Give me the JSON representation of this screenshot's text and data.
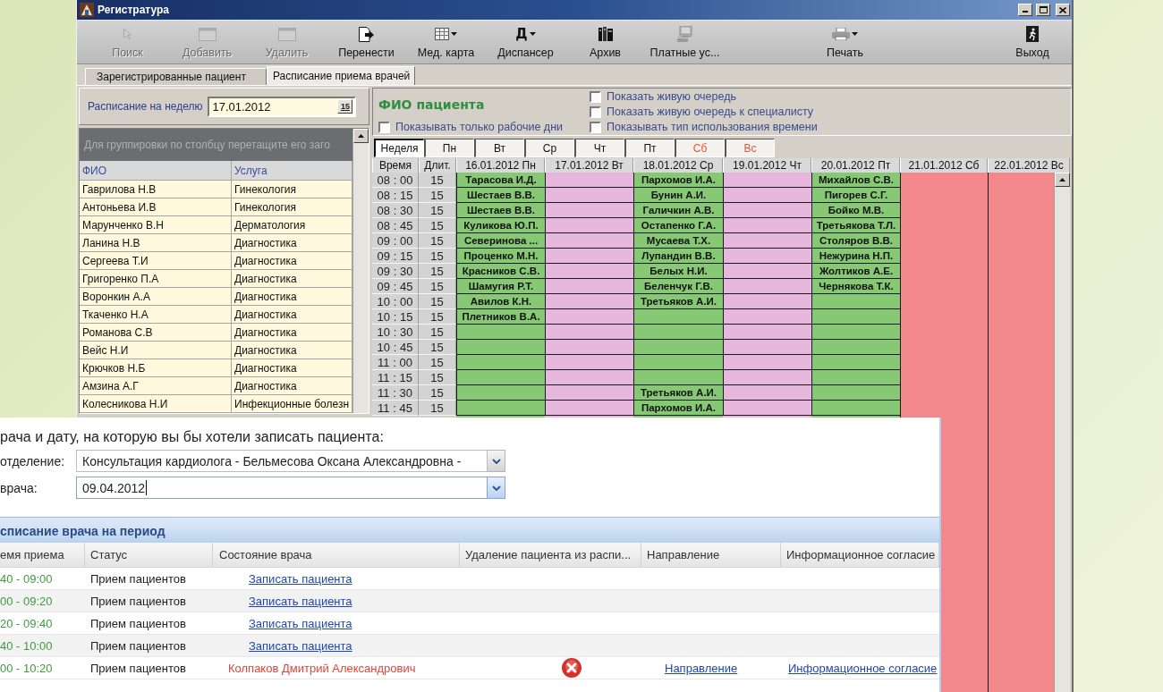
{
  "window": {
    "title": "Регистратура"
  },
  "toolbar": {
    "groups": [
      [
        {
          "label": "Поиск",
          "disabled": true,
          "dropdown": false
        },
        {
          "label": "Добавить",
          "disabled": true,
          "dropdown": false
        },
        {
          "label": "Удалить",
          "disabled": true,
          "dropdown": false
        },
        {
          "label": "Перенести",
          "disabled": false,
          "dropdown": false
        },
        {
          "label": "Мед. карта",
          "disabled": false,
          "dropdown": true
        },
        {
          "label": "Диспансер",
          "disabled": false,
          "dropdown": true,
          "glyph": "Д"
        },
        {
          "label": "Архив",
          "disabled": false,
          "dropdown": false
        },
        {
          "label": "Платные ус...",
          "disabled": false,
          "dropdown": false
        }
      ],
      [
        {
          "label": "Печать",
          "disabled": false,
          "dropdown": true
        }
      ],
      [
        {
          "label": "Выход",
          "disabled": false,
          "dropdown": false
        }
      ]
    ]
  },
  "tabs": [
    {
      "label": "Зарегистрированные пациент",
      "selected": false
    },
    {
      "label": "Расписание приема врачей",
      "selected": true
    }
  ],
  "week_filter": {
    "label": "Расписание на неделю",
    "value": "17.01.2012",
    "calendar_button": "15"
  },
  "doctors": {
    "group_hint": "Для группировки по столбцу перетащите его заго",
    "columns": [
      "ФИО",
      "Услуга"
    ],
    "rows": [
      {
        "name": "Гаврилова Н.В",
        "service": "Гинекология"
      },
      {
        "name": "Антоньева И.В",
        "service": "Гинекология"
      },
      {
        "name": "Марунченко В.Н",
        "service": "Дерматология"
      },
      {
        "name": "Ланина Н.В",
        "service": "Диагностика"
      },
      {
        "name": "Сергеева Т.И",
        "service": "Диагностика"
      },
      {
        "name": "Григоренко П.А",
        "service": "Диагностика"
      },
      {
        "name": "Воронкин А.А",
        "service": "Диагностика"
      },
      {
        "name": "Ткаченко Н.А",
        "service": "Диагностика"
      },
      {
        "name": "Романова С.В",
        "service": "Диагностика"
      },
      {
        "name": "Вейс Н.И",
        "service": "Диагностика"
      },
      {
        "name": "Крючков Н.Б",
        "service": "Диагностика"
      },
      {
        "name": "Амзина А.Г",
        "service": "Диагностика"
      },
      {
        "name": "Колесникова Н.И",
        "service": "Инфекционные болезн"
      }
    ]
  },
  "schedule": {
    "patient_label": "ФИО пациента",
    "working_days_only": {
      "label": "Показывать только рабочие дни",
      "checked": false
    },
    "options": [
      {
        "label": "Показать живую очередь",
        "checked": false
      },
      {
        "label": "Показать живую очередь к специалисту",
        "checked": false
      },
      {
        "label": "Показывать тип использования времени",
        "checked": false
      }
    ],
    "day_tabs": [
      {
        "label": "Неделя",
        "selected": true,
        "weekend": false
      },
      {
        "label": "Пн",
        "selected": false,
        "weekend": false
      },
      {
        "label": "Вт",
        "selected": false,
        "weekend": false
      },
      {
        "label": "Ср",
        "selected": false,
        "weekend": false
      },
      {
        "label": "Чт",
        "selected": false,
        "weekend": false
      },
      {
        "label": "Пт",
        "selected": false,
        "weekend": false
      },
      {
        "label": "Сб",
        "selected": false,
        "weekend": true
      },
      {
        "label": "Вс",
        "selected": false,
        "weekend": true
      }
    ],
    "time_header": "Время",
    "duration_header": "Длит.",
    "rows": [
      {
        "time": "08 : 00",
        "duration": "15"
      },
      {
        "time": "08 : 15",
        "duration": "15"
      },
      {
        "time": "08 : 30",
        "duration": "15"
      },
      {
        "time": "08 : 45",
        "duration": "15"
      },
      {
        "time": "09 : 00",
        "duration": "15"
      },
      {
        "time": "09 : 15",
        "duration": "15"
      },
      {
        "time": "09 : 30",
        "duration": "15"
      },
      {
        "time": "09 : 45",
        "duration": "15"
      },
      {
        "time": "10 : 00",
        "duration": "15"
      },
      {
        "time": "10 : 15",
        "duration": "15"
      },
      {
        "time": "10 : 30",
        "duration": "15"
      },
      {
        "time": "10 : 45",
        "duration": "15"
      },
      {
        "time": "11 : 00",
        "duration": "15"
      },
      {
        "time": "11 : 15",
        "duration": "15"
      },
      {
        "time": "11 : 30",
        "duration": "15"
      },
      {
        "time": "11 : 45",
        "duration": "15"
      }
    ],
    "days": [
      {
        "label": "16.01.2012 Пн",
        "kind": "open",
        "slots": [
          {
            "kind": "booked",
            "patient": "Тарасова И.Д."
          },
          {
            "kind": "booked",
            "patient": "Шестаев В.В."
          },
          {
            "kind": "booked",
            "patient": "Шестаев В.В."
          },
          {
            "kind": "booked",
            "patient": "Куликова Ю.П."
          },
          {
            "kind": "booked",
            "patient": "Северинова ..."
          },
          {
            "kind": "booked",
            "patient": "Проценко М.Н."
          },
          {
            "kind": "booked",
            "patient": "Красников С.В."
          },
          {
            "kind": "booked",
            "patient": "Шамугия Р.Т."
          },
          {
            "kind": "booked",
            "patient": "Авилов К.Н."
          },
          {
            "kind": "booked",
            "patient": "Плетников В.А."
          },
          {
            "kind": "free"
          },
          {
            "kind": "free"
          },
          {
            "kind": "free"
          },
          {
            "kind": "free"
          },
          {
            "kind": "free"
          },
          {
            "kind": "free"
          }
        ]
      },
      {
        "label": "17.01.2012 Вт",
        "kind": "closed"
      },
      {
        "label": "18.01.2012 Ср",
        "kind": "open",
        "slots": [
          {
            "kind": "booked",
            "patient": "Пархомов И.А."
          },
          {
            "kind": "booked",
            "patient": "Бунин А.И."
          },
          {
            "kind": "booked",
            "patient": "Галичкин А.В."
          },
          {
            "kind": "booked",
            "patient": "Остапенко Г.А."
          },
          {
            "kind": "booked",
            "patient": "Мусаева Т.Х."
          },
          {
            "kind": "booked",
            "patient": "Лупандин В.В."
          },
          {
            "kind": "booked",
            "patient": "Белых Н.И."
          },
          {
            "kind": "booked",
            "patient": "Беленчук Г.В."
          },
          {
            "kind": "booked",
            "patient": "Третьяков А.И."
          },
          {
            "kind": "free"
          },
          {
            "kind": "free"
          },
          {
            "kind": "free"
          },
          {
            "kind": "free"
          },
          {
            "kind": "free"
          },
          {
            "kind": "booked",
            "patient": "Третьяков А.И."
          },
          {
            "kind": "booked",
            "patient": "Пархомов И.А."
          }
        ]
      },
      {
        "label": "19.01.2012 Чт",
        "kind": "closed"
      },
      {
        "label": "20.01.2012 Пт",
        "kind": "open",
        "slots": [
          {
            "kind": "booked",
            "patient": "Михайлов С.В."
          },
          {
            "kind": "booked",
            "patient": "Пигорев С.Г."
          },
          {
            "kind": "booked",
            "patient": "Бойко М.В."
          },
          {
            "kind": "booked",
            "patient": "Третьякова Т.Л."
          },
          {
            "kind": "booked",
            "patient": "Столяров В.В."
          },
          {
            "kind": "booked",
            "patient": "Нежурина Н.П."
          },
          {
            "kind": "booked",
            "patient": "Жолтиков А.Е."
          },
          {
            "kind": "booked",
            "patient": "Чернякова Т.К."
          },
          {
            "kind": "free"
          },
          {
            "kind": "free"
          },
          {
            "kind": "free"
          },
          {
            "kind": "free"
          },
          {
            "kind": "free"
          },
          {
            "kind": "free"
          },
          {
            "kind": "free"
          },
          {
            "kind": "free"
          }
        ]
      },
      {
        "label": "21.01.2012 Сб",
        "kind": "weekend"
      },
      {
        "label": "22.01.2012 Вс",
        "kind": "weekend"
      }
    ]
  },
  "booking": {
    "prompt": "рача и дату, на которую вы бы хотели записать пациента:",
    "fields": [
      {
        "label": "отделение:",
        "value": "Консультация кардиолога - Бельмесова Оксана Александровна -",
        "focused": false
      },
      {
        "label": "врача:",
        "value": "09.04.2012",
        "focused": true
      }
    ],
    "section_title": "списание врача на период",
    "columns": [
      "емя приема",
      "Статус",
      "Состояние врача",
      "Удаление пациента из распи...",
      "Направление",
      "Информационное согласие"
    ],
    "rows": [
      {
        "time": "40 - 09:00",
        "status": "Прием пациентов",
        "state": {
          "kind": "link",
          "text": "Записать пациента"
        },
        "removable": false
      },
      {
        "time": "00 - 09:20",
        "status": "Прием пациентов",
        "state": {
          "kind": "link",
          "text": "Записать пациента"
        },
        "removable": false
      },
      {
        "time": "20 - 09:40",
        "status": "Прием пациентов",
        "state": {
          "kind": "link",
          "text": "Записать пациента"
        },
        "removable": false
      },
      {
        "time": "40 - 10:00",
        "status": "Прием пациентов",
        "state": {
          "kind": "link",
          "text": "Записать пациента"
        },
        "removable": false
      },
      {
        "time": "00 - 10:20",
        "status": "Прием пациентов",
        "state": {
          "kind": "patient",
          "text": "Колпаков Дмитрий Александрович"
        },
        "removable": true,
        "referral": "Направление",
        "consent": "Информационное согласие"
      }
    ]
  }
}
